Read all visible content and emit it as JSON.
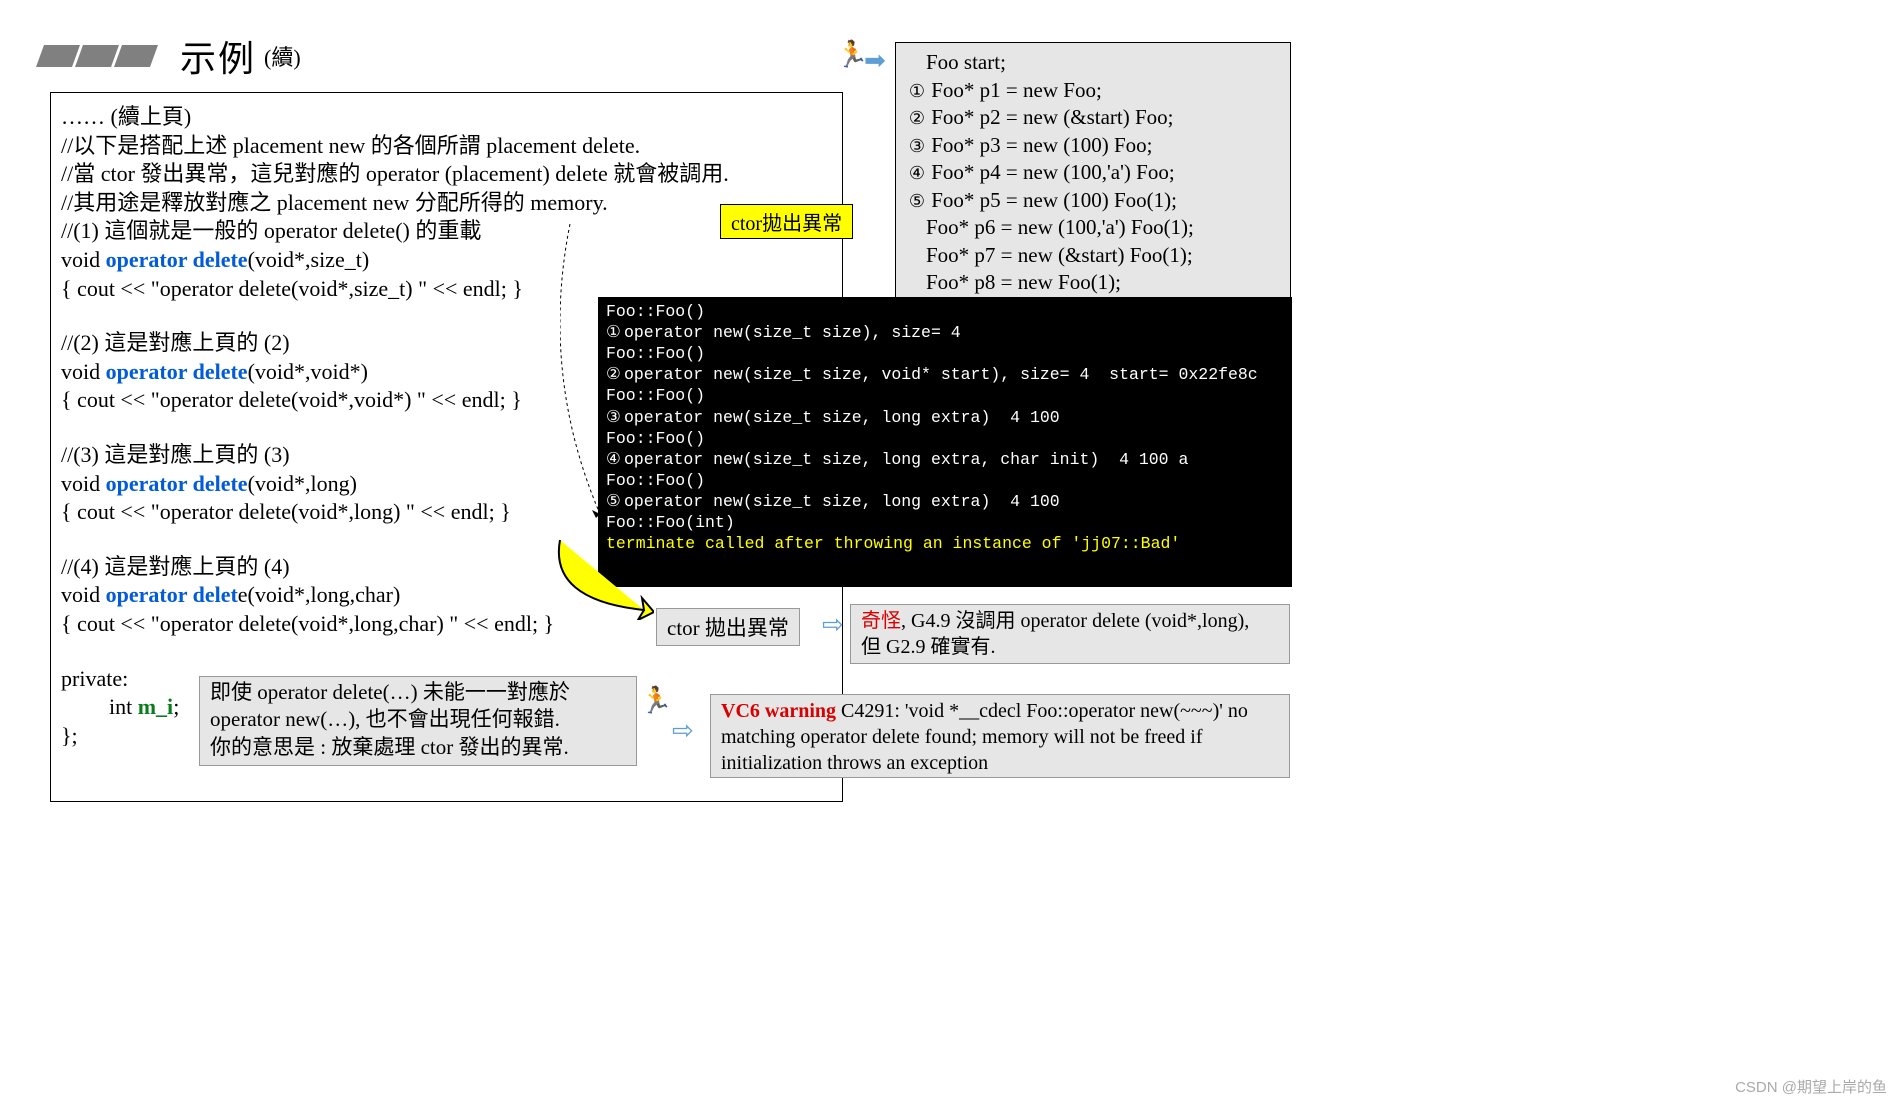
{
  "title": "示例",
  "subtitle": "(續)",
  "main": {
    "cont": "…… (續上頁)",
    "c1": "//以下是搭配上述 placement new 的各個所謂 placement delete.",
    "c2": "//當 ctor 發出異常，這兒對應的 operator (placement) delete 就會被調用.",
    "c3": "//其用途是釋放對應之 placement new 分配所得的 memory.",
    "d1c": "//(1) 這個就是一般的 operator delete() 的重載",
    "d1a": "void ",
    "d1b": "operator delete",
    "d1s": "(void*,size_t)",
    "d1o": "{ cout << \"operator delete(void*,size_t)  \" << endl;  }",
    "d2c": "//(2) 這是對應上頁的 (2)",
    "d2a": "void ",
    "d2b": "operator delete",
    "d2s": "(void*,void*)",
    "d2o": "{ cout << \"operator delete(void*,void*)  \" << endl;  }",
    "d3c": "//(3) 這是對應上頁的 (3)",
    "d3a": "void ",
    "d3b": "operator delete",
    "d3s": "(void*,long)",
    "d3o": "{ cout << \"operator delete(void*,long)  \" << endl;  }",
    "d4c": "//(4) 這是對應上頁的 (4)",
    "d4a": "void ",
    "d4b": "operator delet",
    "d4s": "e(void*,long,char)",
    "d4o": "{ cout << \"operator delete(void*,long,char)  \" << endl;  }",
    "pr": "private:",
    "mia": "int ",
    "mib": "m_i",
    "mic": ";",
    "cl": "};"
  },
  "ylabel": "ctor拋出異常",
  "right": {
    "l0": "Foo  start;",
    "n1": "①",
    "l1": " Foo*  p1 = new Foo;",
    "n2": "②",
    "l2": " Foo*  p2 = new (&start) Foo;",
    "n3": "③",
    "l3": " Foo*  p3 = new (100) Foo;",
    "n4": "④",
    "l4": " Foo*  p4 = new (100,'a') Foo;",
    "n5": "⑤",
    "l5": " Foo*  p5 = new (100) Foo(1);",
    "l6": " Foo*  p6 = new (100,'a') Foo(1);",
    "l7": " Foo*  p7 = new (&start) Foo(1);",
    "l8": " Foo*  p8 = new Foo(1);"
  },
  "console": {
    "l0": "Foo::Foo()",
    "n1": "①",
    "l1": "operator new(size_t size), size= 4",
    "l2": "Foo::Foo()",
    "n2": "②",
    "l3": "operator new(size_t size, void* start), size= 4  start= 0x22fe8c",
    "l4": "Foo::Foo()",
    "n3": "③",
    "l5": "operator new(size_t size, long extra)  4 100",
    "l6": "Foo::Foo()",
    "n4": "④",
    "l7": "operator new(size_t size, long extra, char init)  4 100 a",
    "l8": "Foo::Foo()",
    "n5": "⑤",
    "l9": "operator new(size_t size, long extra)  4 100",
    "l10": "Foo::Foo(int)",
    "l11": "terminate called after throwing an instance of 'jj07::Bad'"
  },
  "ctor_thrown": "ctor 拋出異常",
  "note1a": "奇怪",
  "note1b": ", G4.9 沒調用 operator delete (void*,long),",
  "note1c": "但 G2.9 確實有.",
  "note2a": "VC6 warning",
  "note2b": " C4291: 'void *__cdecl Foo::operator new(~~~)'  no matching operator delete found; memory will not be freed if initialization throws an exception",
  "innote": {
    "l1": "即使 operator delete(…) 未能一一對應於",
    "l2": "operator new(…), 也不會出現任何報錯.",
    "l3": "你的意思是 : 放棄處理 ctor 發出的異常."
  },
  "watermark": "CSDN @期望上岸的鱼"
}
